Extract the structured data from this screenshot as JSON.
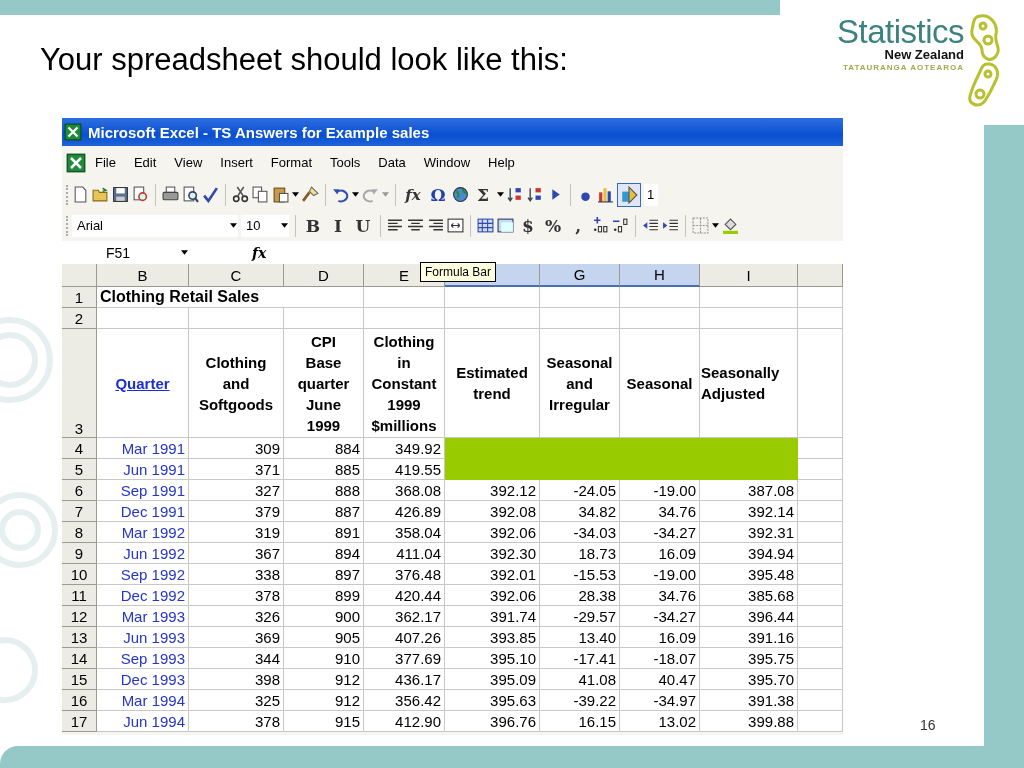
{
  "slide": {
    "title": "Your spreadsheet should look like this:",
    "page_number": "16",
    "logo": {
      "name": "Statistics",
      "subtitle": "New Zealand",
      "tagline": "TATAURANGA AOTEAROA"
    }
  },
  "window": {
    "title": "Microsoft Excel - TS Answers for Example sales"
  },
  "menu": [
    {
      "label": "File"
    },
    {
      "label": "Edit"
    },
    {
      "label": "View"
    },
    {
      "label": "Insert"
    },
    {
      "label": "Format"
    },
    {
      "label": "Tools"
    },
    {
      "label": "Data"
    },
    {
      "label": "Window"
    },
    {
      "label": "Help"
    }
  ],
  "standard_toolbar": {
    "glyphs": [
      "fx",
      "Ω",
      "Σ"
    ],
    "cut_field": "1"
  },
  "formatting_toolbar": {
    "font": "Arial",
    "size": "10",
    "style_buttons": [
      "B",
      "I",
      "U"
    ],
    "number_buttons": [
      "$",
      "%",
      ","
    ]
  },
  "formula_bar": {
    "name_box": "F51",
    "function_label": "fx"
  },
  "tooltip": "Formula Bar",
  "columns": [
    {
      "label": "B",
      "selected": false
    },
    {
      "label": "C",
      "selected": false
    },
    {
      "label": "D",
      "selected": false
    },
    {
      "label": "E",
      "selected": false
    },
    {
      "selected": true
    },
    {
      "label": "G",
      "selected": true
    },
    {
      "label": "H",
      "selected": true
    },
    {
      "label": "I",
      "selected": false
    }
  ],
  "rows": [
    {
      "number": "1",
      "kind": "title",
      "cells": [
        "Clothing Retail Sales"
      ]
    },
    {
      "number": "2",
      "kind": "blank"
    },
    {
      "number": "3",
      "kind": "header",
      "cells": [
        "Quarter",
        "Clothing\nand\nSoftgoods",
        "CPI\nBase\nquarter\nJune\n1999",
        "Clothing\nin\nConstant\n1999\n$millions",
        "Estimated\ntrend",
        "Seasonal\nand\nIrregular",
        "Seasonal",
        "Seasonally\nAdjusted"
      ]
    },
    {
      "number": "4",
      "kind": "data",
      "highlighted": true,
      "cells": [
        "Mar 1991",
        "309",
        "884",
        "349.92"
      ]
    },
    {
      "number": "5",
      "kind": "data",
      "highlighted": true,
      "cells": [
        "Jun 1991",
        "371",
        "885",
        "419.55"
      ]
    },
    {
      "number": "6",
      "kind": "data",
      "highlighted": false,
      "cells": [
        "Sep 1991",
        "327",
        "888",
        "368.08",
        "392.12",
        "-24.05",
        "-19.00",
        "387.08"
      ]
    },
    {
      "number": "7",
      "kind": "data",
      "highlighted": false,
      "cells": [
        "Dec 1991",
        "379",
        "887",
        "426.89",
        "392.08",
        "34.82",
        "34.76",
        "392.14"
      ]
    },
    {
      "number": "8",
      "kind": "data",
      "highlighted": false,
      "cells": [
        "Mar 1992",
        "319",
        "891",
        "358.04",
        "392.06",
        "-34.03",
        "-34.27",
        "392.31"
      ]
    },
    {
      "number": "9",
      "kind": "data",
      "highlighted": false,
      "cells": [
        "Jun 1992",
        "367",
        "894",
        "411.04",
        "392.30",
        "18.73",
        "16.09",
        "394.94"
      ]
    },
    {
      "number": "10",
      "kind": "data",
      "highlighted": false,
      "cells": [
        "Sep 1992",
        "338",
        "897",
        "376.48",
        "392.01",
        "-15.53",
        "-19.00",
        "395.48"
      ]
    },
    {
      "number": "11",
      "kind": "data",
      "highlighted": false,
      "cells": [
        "Dec 1992",
        "378",
        "899",
        "420.44",
        "392.06",
        "28.38",
        "34.76",
        "385.68"
      ]
    },
    {
      "number": "12",
      "kind": "data",
      "highlighted": false,
      "cells": [
        "Mar 1993",
        "326",
        "900",
        "362.17",
        "391.74",
        "-29.57",
        "-34.27",
        "396.44"
      ]
    },
    {
      "number": "13",
      "kind": "data",
      "highlighted": false,
      "cells": [
        "Jun 1993",
        "369",
        "905",
        "407.26",
        "393.85",
        "13.40",
        "16.09",
        "391.16"
      ]
    },
    {
      "number": "14",
      "kind": "data",
      "highlighted": false,
      "cells": [
        "Sep 1993",
        "344",
        "910",
        "377.69",
        "395.10",
        "-17.41",
        "-18.07",
        "395.75"
      ]
    },
    {
      "number": "15",
      "kind": "data",
      "highlighted": false,
      "cells": [
        "Dec 1993",
        "398",
        "912",
        "436.17",
        "395.09",
        "41.08",
        "40.47",
        "395.70"
      ]
    },
    {
      "number": "16",
      "kind": "data",
      "highlighted": false,
      "cells": [
        "Mar 1994",
        "325",
        "912",
        "356.42",
        "395.63",
        "-39.22",
        "-34.97",
        "391.38"
      ]
    },
    {
      "number": "17",
      "kind": "data",
      "highlighted": false,
      "cells": [
        "Jun 1994",
        "378",
        "915",
        "412.90",
        "396.76",
        "16.15",
        "13.02",
        "399.88"
      ]
    }
  ]
}
